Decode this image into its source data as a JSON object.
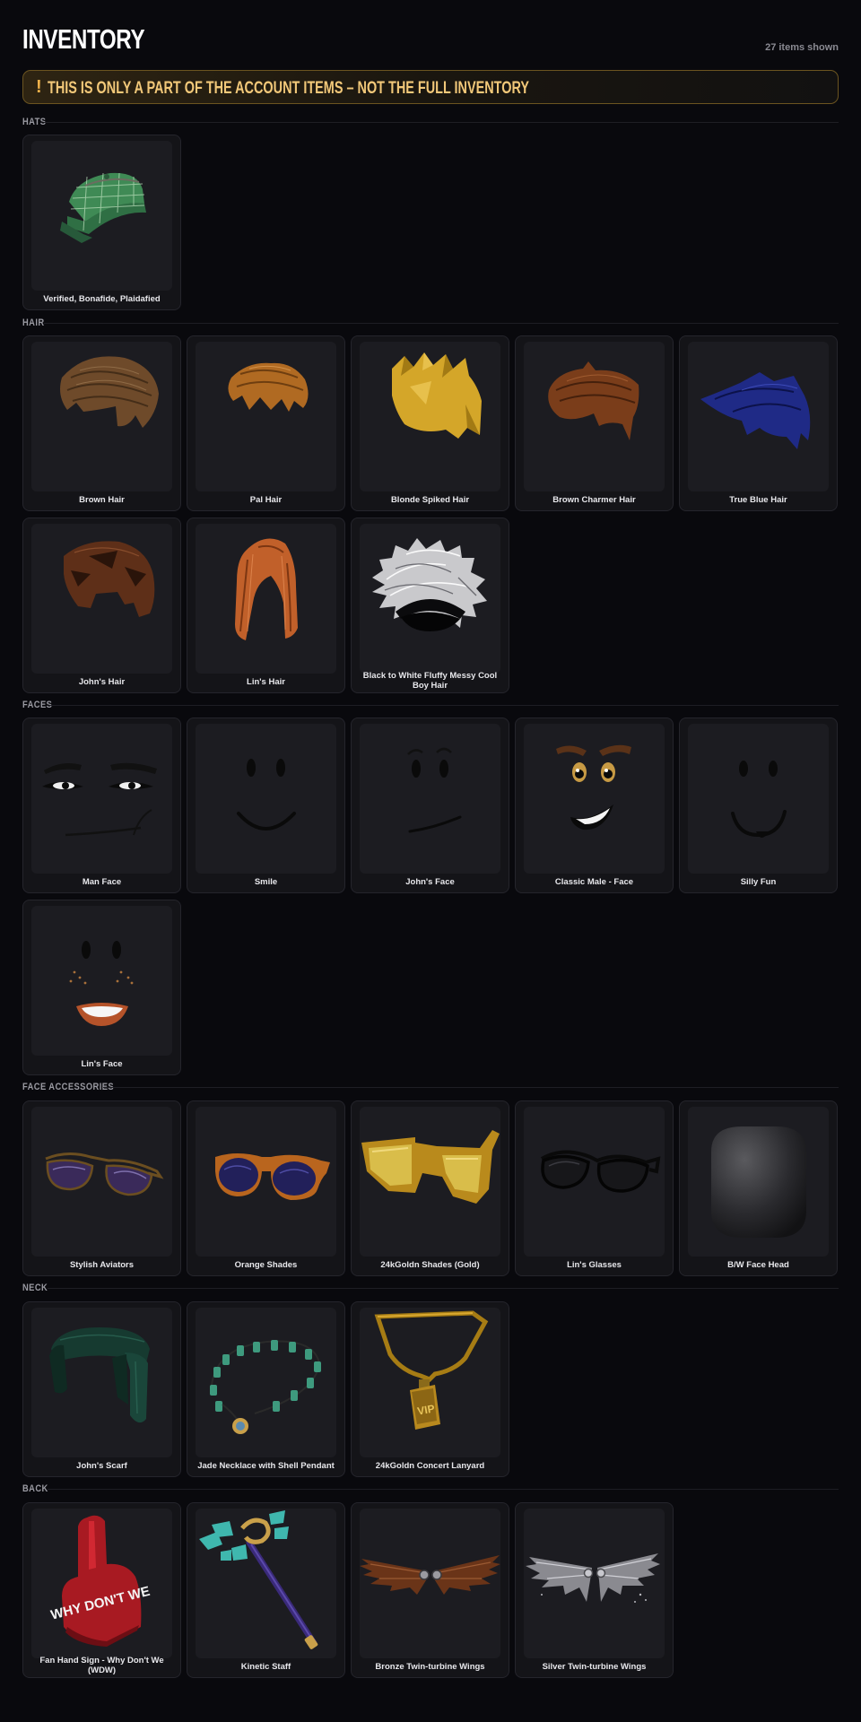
{
  "page": {
    "title": "INVENTORY",
    "count": "27 items shown",
    "banner_icon": "!",
    "banner": "THIS IS ONLY A PART OF THE ACCOUNT ITEMS – NOT THE FULL INVENTORY"
  },
  "sections": {
    "hats": {
      "label": "HATS",
      "items": [
        "Verified, Bonafide, Plaidafied"
      ]
    },
    "hair": {
      "label": "HAIR",
      "items": [
        "Brown Hair",
        "Pal Hair",
        "Blonde Spiked Hair",
        "Brown Charmer Hair",
        "True Blue Hair",
        "John's Hair",
        "Lin's Hair",
        "Black to White Fluffy Messy Cool Boy Hair"
      ]
    },
    "faces": {
      "label": "FACES",
      "items": [
        "Man Face",
        "Smile",
        "John's Face",
        "Classic Male - Face",
        "Silly Fun",
        "Lin's Face"
      ]
    },
    "face_accessories": {
      "label": "FACE ACCESSORIES",
      "items": [
        "Stylish Aviators",
        "Orange Shades",
        "24kGoldn Shades (Gold)",
        "Lin's Glasses",
        "B/W Face Head"
      ]
    },
    "neck": {
      "label": "NECK",
      "items": [
        "John's Scarf",
        "Jade Necklace with Shell Pendant",
        "24kGoldn Concert Lanyard"
      ]
    },
    "back": {
      "label": "BACK",
      "items": [
        "Fan Hand Sign - Why Don't We (WDW)",
        "Kinetic Staff",
        "Bronze Twin-turbine Wings",
        "Silver Twin-turbine Wings"
      ]
    }
  },
  "sign_text": "WHY DON'T WE",
  "lanyard_text": "VIP",
  "colors": {
    "accent": "#f2c879",
    "banner_border": "#6b5420",
    "background": "#09090d",
    "card": "#141418"
  }
}
